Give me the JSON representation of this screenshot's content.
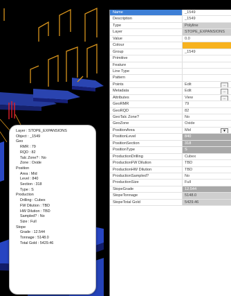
{
  "tooltip": {
    "lines": [
      {
        "text": "Layer : STOPE_EXPANSIONS",
        "indent": false
      },
      {
        "text": "Object : _1549",
        "indent": false
      },
      {
        "text": "Geo",
        "indent": false
      },
      {
        "text": "RMR : 79",
        "indent": true
      },
      {
        "text": "RQD : 82",
        "indent": true
      },
      {
        "text": "Talc Zone? : No",
        "indent": true
      },
      {
        "text": "Zone : Oxide",
        "indent": true
      },
      {
        "text": "Position",
        "indent": false
      },
      {
        "text": "Area : Mid",
        "indent": true
      },
      {
        "text": "Level : 840",
        "indent": true
      },
      {
        "text": "Section : 318",
        "indent": true
      },
      {
        "text": "Type : S",
        "indent": true
      },
      {
        "text": "Production",
        "indent": false
      },
      {
        "text": "Drilling : Cubex",
        "indent": true
      },
      {
        "text": "FW Dilution : TBD",
        "indent": true
      },
      {
        "text": "HW Dilution : TBD",
        "indent": true
      },
      {
        "text": "Sampled? : No",
        "indent": true
      },
      {
        "text": "Size : Full",
        "indent": true
      },
      {
        "text": "Stope",
        "indent": false
      },
      {
        "text": "Grade : 12.544",
        "indent": true
      },
      {
        "text": "Tonnage : 5148.0",
        "indent": true
      },
      {
        "text": "Total Gold : 5429.46",
        "indent": true
      }
    ]
  },
  "properties": [
    {
      "name": "Name",
      "value": "_1549",
      "selected": true,
      "style": ""
    },
    {
      "name": "Description",
      "value": "_1549",
      "style": ""
    },
    {
      "name": "Type",
      "value": "Polyline",
      "style": "gray"
    },
    {
      "name": "Layer",
      "value": "STOPE_EXPANSIONS",
      "style": "gray"
    },
    {
      "name": "Value",
      "value": "0.0",
      "style": ""
    },
    {
      "name": "Colour",
      "value": "",
      "style": "orange"
    },
    {
      "name": "Group",
      "value": "_1549",
      "style": ""
    },
    {
      "name": "Primitive",
      "value": "",
      "style": ""
    },
    {
      "name": "Feature",
      "value": "",
      "style": ""
    },
    {
      "name": "Line Type",
      "value": "",
      "style": ""
    },
    {
      "name": "Pattern",
      "value": "",
      "style": ""
    },
    {
      "name": "Points",
      "value": "Edit",
      "style": "",
      "button": "..."
    },
    {
      "name": "Metadata",
      "value": "Edit",
      "style": "",
      "button": "..."
    },
    {
      "name": "Attributes",
      "value": "View",
      "style": "",
      "button": "..."
    },
    {
      "name": "GeoRMR",
      "value": "79",
      "style": ""
    },
    {
      "name": "GeoRQD",
      "value": "82",
      "style": ""
    },
    {
      "name": "GeoTalc Zone?",
      "value": "No",
      "style": ""
    },
    {
      "name": "GeoZone",
      "value": "Oxide",
      "style": ""
    },
    {
      "name": "PositionArea",
      "value": "Mid",
      "style": "",
      "dropdown": "▼"
    },
    {
      "name": "PositionLevel",
      "value": "840",
      "style": "dark"
    },
    {
      "name": "PositionSection",
      "value": "318",
      "style": "dark"
    },
    {
      "name": "PositionType",
      "value": "S",
      "style": "dark"
    },
    {
      "name": "ProductionDrilling",
      "value": "Cubex",
      "style": ""
    },
    {
      "name": "ProductionFW Dilution",
      "value": "TBD",
      "style": ""
    },
    {
      "name": "ProductionHW Dilution",
      "value": "TBD",
      "style": ""
    },
    {
      "name": "ProductionSampled?",
      "value": "No",
      "style": ""
    },
    {
      "name": "ProductionSize",
      "value": "Full",
      "style": ""
    },
    {
      "name": "StopeGrade",
      "value": "12.544",
      "style": "dark"
    },
    {
      "name": "StopeTonnage",
      "value": "5148.0",
      "style": "gray"
    },
    {
      "name": "StopeTotal Gold",
      "value": "5429.46",
      "style": "gray"
    }
  ]
}
